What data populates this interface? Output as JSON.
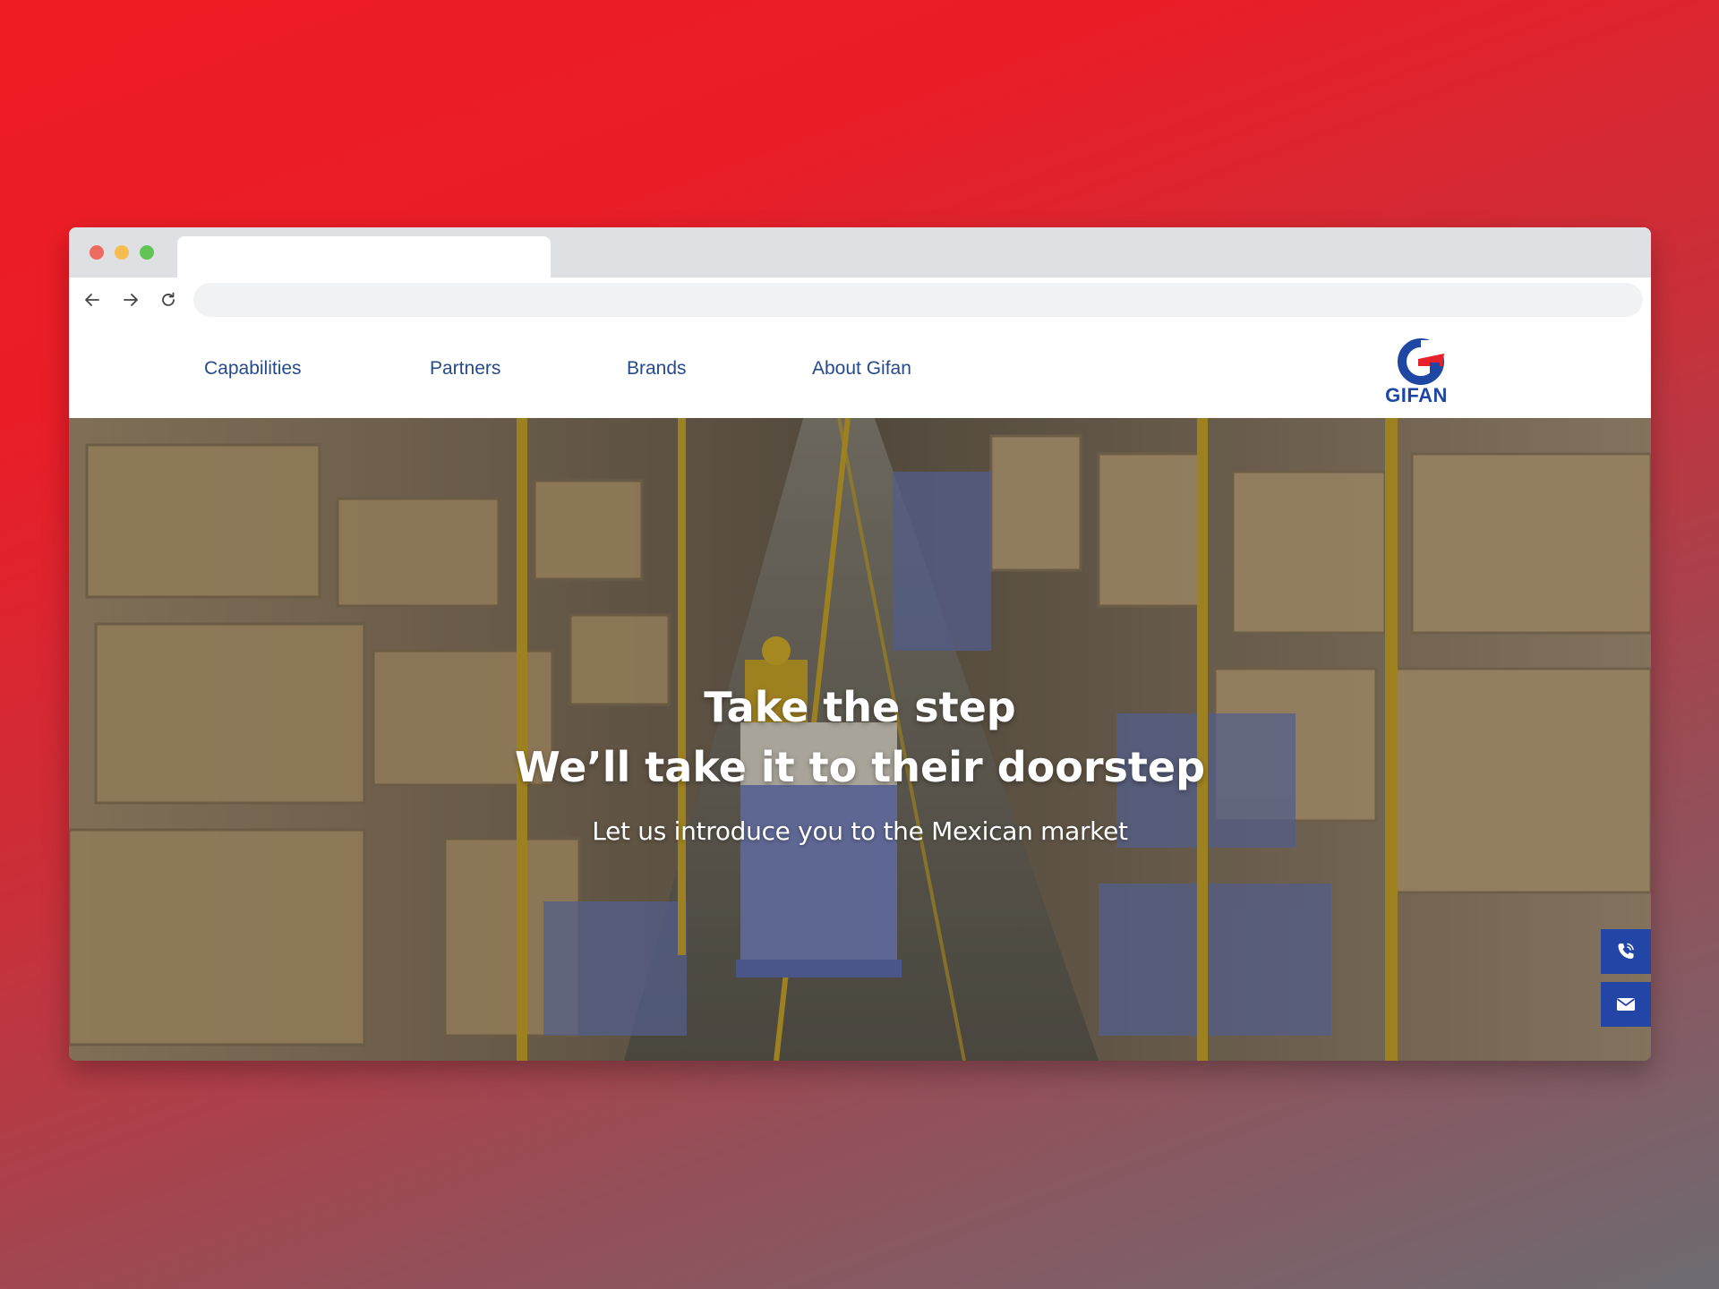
{
  "browser": {
    "address_bar": {
      "value": ""
    },
    "controls": {
      "back_icon": "arrow-left-icon",
      "forward_icon": "arrow-right-icon",
      "reload_icon": "reload-icon"
    }
  },
  "header": {
    "nav": [
      {
        "label": "Capabilities"
      },
      {
        "label": "Partners"
      },
      {
        "label": "Brands"
      },
      {
        "label": "About Gifan"
      }
    ],
    "logo": {
      "text": "GIFAN",
      "icon": "gifan-g-logo"
    }
  },
  "hero": {
    "title_line1": "Take the step",
    "title_line2": "We’ll take it to their doorstep",
    "subtitle": "Let us introduce you to the Mexican market",
    "background": "warehouse-aisle-photo"
  },
  "side_buttons": [
    {
      "icon": "phone-icon"
    },
    {
      "icon": "mail-icon"
    }
  ],
  "colors": {
    "nav_text": "#274a8a",
    "brand_blue": "#1e46a3",
    "brand_red": "#e8202b",
    "side_button": "#2346a6",
    "backdrop_top": "#ee1c25",
    "backdrop_bottom": "#6e6c73"
  }
}
